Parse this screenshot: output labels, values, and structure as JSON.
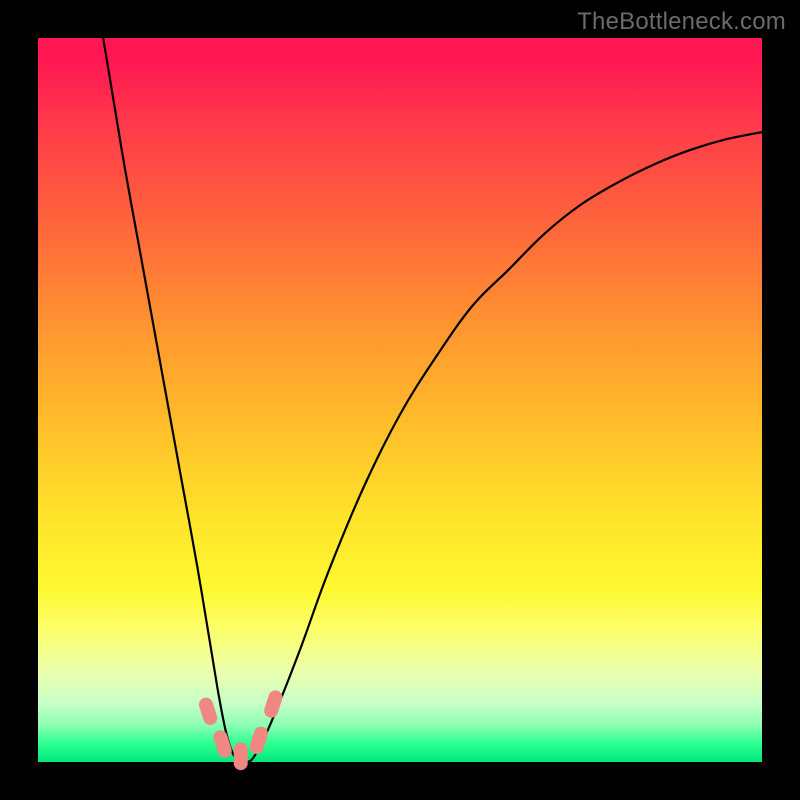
{
  "watermark": "TheBottleneck.com",
  "chart_data": {
    "type": "line",
    "title": "",
    "xlabel": "",
    "ylabel": "",
    "xlim": [
      0,
      100
    ],
    "ylim": [
      0,
      100
    ],
    "series": [
      {
        "name": "bottleneck-curve",
        "x": [
          9,
          10,
          12,
          14,
          16,
          18,
          20,
          22,
          24,
          25,
          26,
          27,
          28,
          29,
          30,
          32,
          36,
          40,
          45,
          50,
          55,
          60,
          65,
          70,
          75,
          80,
          85,
          90,
          95,
          100
        ],
        "values": [
          100,
          94,
          82,
          71,
          60,
          49,
          38,
          27,
          15,
          9,
          4,
          1,
          0,
          0,
          1,
          5,
          15,
          26,
          38,
          48,
          56,
          63,
          68,
          73,
          77,
          80,
          82.5,
          84.5,
          86,
          87
        ]
      }
    ],
    "markers": [
      {
        "name": "marker-1",
        "x": 23.5,
        "y": 7
      },
      {
        "name": "marker-2",
        "x": 25.5,
        "y": 2.5
      },
      {
        "name": "marker-3",
        "x": 28.0,
        "y": 0.8
      },
      {
        "name": "marker-4",
        "x": 30.5,
        "y": 3
      },
      {
        "name": "marker-5",
        "x": 32.5,
        "y": 8
      }
    ],
    "marker_color": "#ef8783",
    "curve_color": "#000000"
  }
}
